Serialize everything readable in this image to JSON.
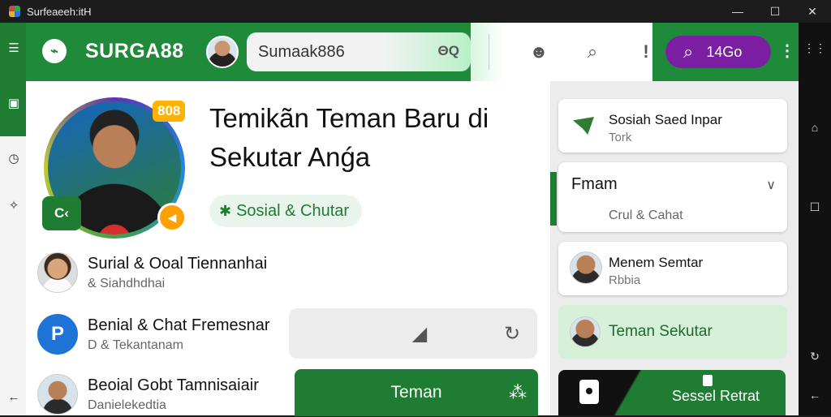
{
  "window": {
    "title": "Surfeaeeh:itH",
    "controls": [
      "—",
      "☐",
      "✕"
    ]
  },
  "left_rail": {
    "icons": [
      "menu-icon",
      "square-icon",
      "clock-icon",
      "puzzle-icon",
      "back-arrow-icon"
    ]
  },
  "right_rail": {
    "icons": [
      "grid-icon",
      "home-icon",
      "square-icon",
      "refresh-icon",
      "back-icon"
    ]
  },
  "header": {
    "logo": "⌁",
    "brand": "SURGA88",
    "search": {
      "value": "Sumaak886",
      "icon_text": "ΘQ"
    },
    "pill": {
      "label": "14Go"
    },
    "colors": {
      "green": "#1e8a3a",
      "purple": "#7b1fa2"
    }
  },
  "profile": {
    "badge_top": "808",
    "badge_green": "C‹",
    "badge_orange": "◀"
  },
  "headline": "Temikãn Teman Baru di Sekutar Anǵa",
  "chip": {
    "label": "Sosial & Chutar"
  },
  "contacts": [
    {
      "name": "Surial & Ooal Tiennanhai",
      "sub": "& Siahdhdhai"
    },
    {
      "name": "Benial & Chat Fremesnar",
      "sub": "D & Tekantanam"
    },
    {
      "name": "Beoial Gobt Tamnisaiair",
      "sub": "Danielekedtia"
    }
  ],
  "bottom_button": {
    "label": "Teman"
  },
  "right_cards": {
    "card1": {
      "title": "Sosiah Saed Inpar",
      "sub": "Tork"
    },
    "card2": {
      "title": "Fmam",
      "sub": "Crul & Cahat"
    },
    "card3": {
      "title": "Menem Semtar",
      "sub": "Rbbia"
    },
    "card4": {
      "title": "Teman Sekutar"
    },
    "card5": {
      "title": "Sessel Retrat"
    }
  }
}
